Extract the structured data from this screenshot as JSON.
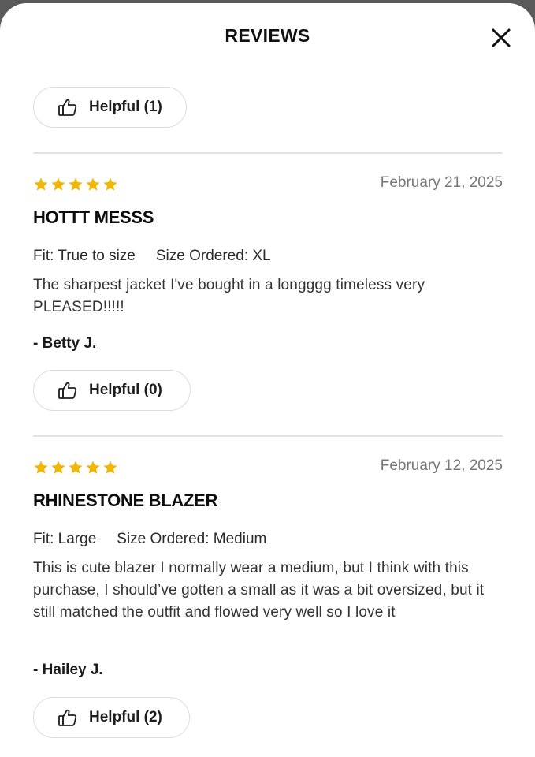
{
  "header": {
    "title": "REVIEWS",
    "close_icon": "close-x-icon"
  },
  "colors": {
    "star": "#F2B705",
    "divider": "#E2E2E2",
    "date": "#777777"
  },
  "top_helpful": {
    "label": "Helpful (1)",
    "icon": "thumbs-up-outline-icon"
  },
  "reviews": [
    {
      "stars": 5,
      "date": "February 21, 2025",
      "title": "HOTTT MESSS",
      "fit": "Fit: True to size",
      "size": "Size Ordered: XL",
      "body": "The sharpest jacket I've bought in a longggg timeless very PLEASED!!!!!",
      "author": "- Betty J.",
      "helpful": "Helpful (0)"
    },
    {
      "stars": 5,
      "date": "February 12, 2025",
      "title": "RHINESTONE BLAZER",
      "fit": "Fit: Large",
      "size": "Size Ordered: Medium",
      "body": "This is cute blazer I normally wear a medium, but I think with this purchase, I should’ve gotten a small as it was a bit oversized, but it still matched the outfit and flowed very well so I love it",
      "author": "- Hailey J.",
      "helpful": "Helpful (2)"
    }
  ]
}
